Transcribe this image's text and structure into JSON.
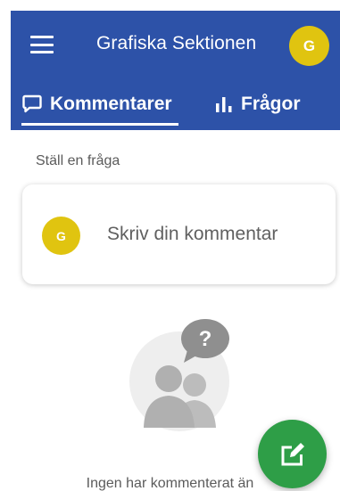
{
  "header": {
    "title": "Grafiska Sektionen",
    "avatar_initial": "G",
    "menu_icon": "menu-icon"
  },
  "tabs": [
    {
      "label": "Kommentarer",
      "icon": "comment-icon",
      "active": true
    },
    {
      "label": "Frågor",
      "icon": "bar-chart-icon",
      "active": false
    }
  ],
  "main": {
    "ask_label": "Ställ en fråga",
    "comment_box": {
      "avatar_initial": "G",
      "placeholder": "Skriv din kommentar"
    },
    "empty_state": {
      "illustration": "people-question-icon",
      "text": "Ingen har kommenterat än"
    }
  },
  "fab": {
    "icon": "edit-icon"
  },
  "colors": {
    "appbar": "#2d52a8",
    "avatar": "#e0c410",
    "fab": "#2e9e47"
  }
}
